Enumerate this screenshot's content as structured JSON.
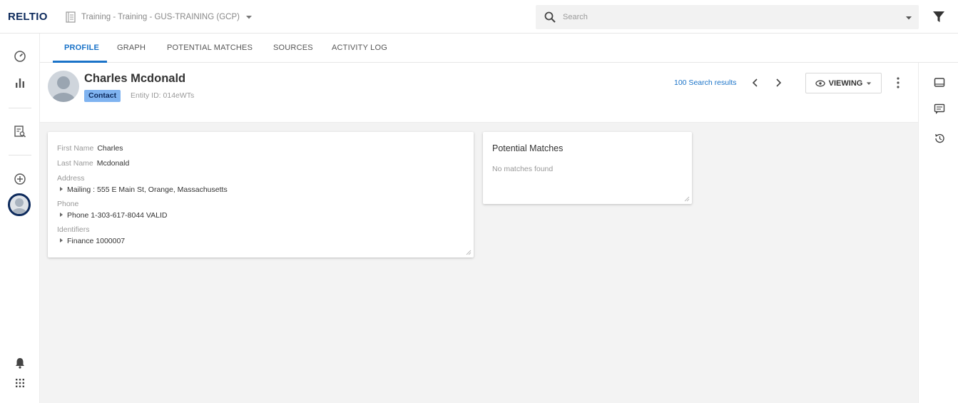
{
  "app": {
    "logo": "RELTIO",
    "tenant": "Training - Training - GUS-TRAINING (GCP)"
  },
  "search": {
    "placeholder": "Search"
  },
  "tabs": [
    {
      "label": "PROFILE",
      "active": true
    },
    {
      "label": "GRAPH",
      "active": false
    },
    {
      "label": "POTENTIAL MATCHES",
      "active": false
    },
    {
      "label": "SOURCES",
      "active": false
    },
    {
      "label": "ACTIVITY LOG",
      "active": false
    }
  ],
  "profile": {
    "name": "Charles Mcdonald",
    "type_badge": "Contact",
    "entity_id": "Entity ID: 014eWTs",
    "search_results": "100 Search results",
    "viewing_label": "VIEWING"
  },
  "attributes": {
    "first_name_label": "First Name",
    "first_name_value": "Charles",
    "last_name_label": "Last Name",
    "last_name_value": "Mcdonald",
    "address_label": "Address",
    "address_value": "Mailing : 555 E Main St, Orange, Massachusetts",
    "phone_label": "Phone",
    "phone_value": "Phone 1-303-617-8044 VALID",
    "identifiers_label": "Identifiers",
    "identifiers_value": "Finance 1000007"
  },
  "potential_matches": {
    "title": "Potential Matches",
    "empty_text": "No matches found"
  },
  "colors": {
    "brand": "#0d2a5c",
    "accent": "#1a73c8",
    "badge_bg": "#7fb3f0",
    "content_bg": "#f3f3f3"
  },
  "icons": {
    "left_rail": [
      "dashboard-icon",
      "analytics-icon",
      "search-results-icon",
      "add-icon",
      "profile-avatar",
      "notifications-icon",
      "apps-grid-icon"
    ],
    "right_rail": [
      "inbox-icon",
      "comments-icon",
      "history-icon"
    ]
  }
}
